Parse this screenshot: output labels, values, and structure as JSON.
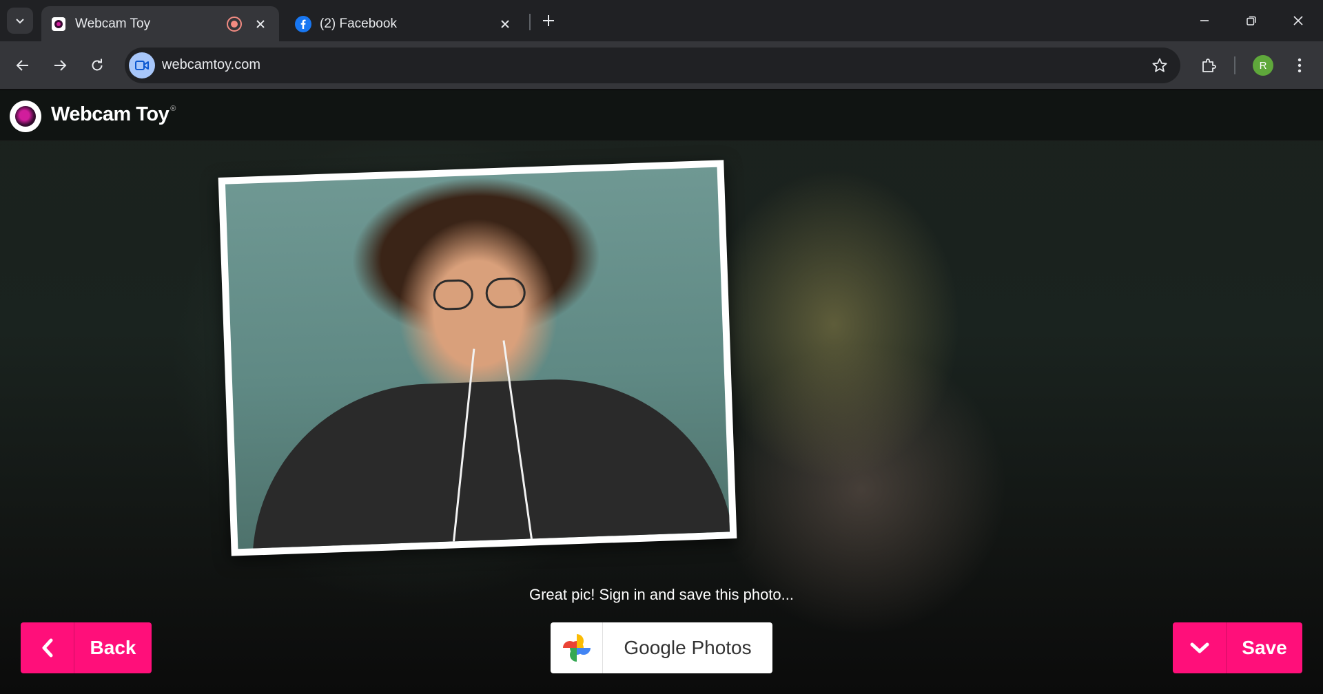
{
  "browser": {
    "tabs": [
      {
        "title": "Webcam Toy",
        "active": true,
        "recording": true
      },
      {
        "title": "(2) Facebook",
        "active": false
      }
    ],
    "url": "webcamtoy.com",
    "profile_initial": "R"
  },
  "app": {
    "brand": "Webcam Toy",
    "brand_mark": "®"
  },
  "main": {
    "prompt": "Great pic! Sign in and save this photo...",
    "back_label": "Back",
    "google_photos_label": "Google Photos",
    "save_label": "Save"
  },
  "colors": {
    "accent": "#ff0f7a",
    "chrome_dark": "#202124",
    "chrome_toolbar": "#35363a"
  },
  "icons": [
    "tab-search-icon",
    "webcam-favicon",
    "recording-icon",
    "close-icon",
    "facebook-icon",
    "plus-icon",
    "minimize-icon",
    "restore-icon",
    "back-arrow-icon",
    "forward-arrow-icon",
    "reload-icon",
    "video-camera-icon",
    "star-icon",
    "extensions-icon",
    "more-vert-icon",
    "chevron-left-icon",
    "google-photos-icon",
    "chevron-down-icon"
  ]
}
